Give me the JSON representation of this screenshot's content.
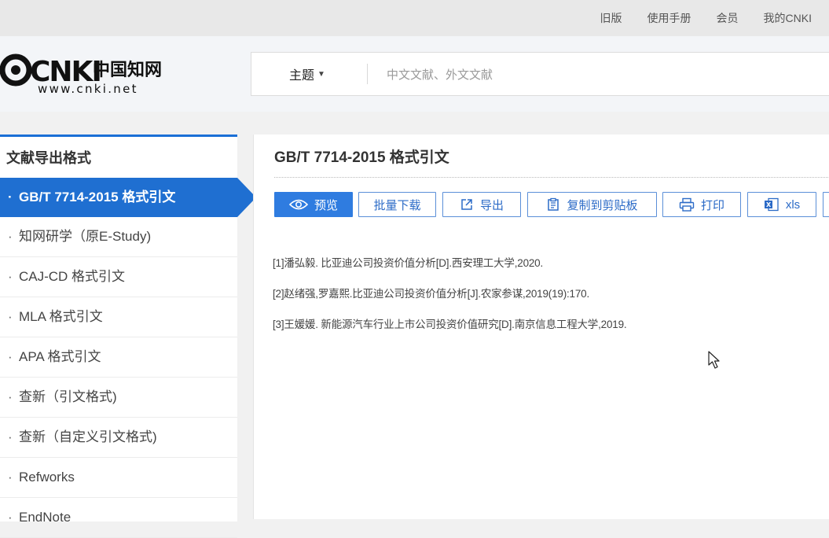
{
  "top_links": [
    "旧版",
    "使用手册",
    "会员",
    "我的CNKI"
  ],
  "logo": {
    "mark": "CNKI",
    "chinese": "中国知网",
    "url_text": "www.cnki.net"
  },
  "search": {
    "field": "主题",
    "placeholder": "中文文献、外文文献",
    "value": ""
  },
  "sidebar": {
    "title": "文献导出格式",
    "items": [
      {
        "label": "GB/T 7714-2015 格式引文",
        "active": true
      },
      {
        "label": "知网研学（原E-Study)",
        "active": false
      },
      {
        "label": "CAJ-CD 格式引文",
        "active": false
      },
      {
        "label": "MLA 格式引文",
        "active": false
      },
      {
        "label": "APA 格式引文",
        "active": false
      },
      {
        "label": "查新（引文格式)",
        "active": false
      },
      {
        "label": "查新（自定义引文格式)",
        "active": false
      },
      {
        "label": "Refworks",
        "active": false
      },
      {
        "label": "EndNote",
        "active": false
      }
    ]
  },
  "main": {
    "title": "GB/T 7714-2015 格式引文",
    "toolbar": {
      "preview": "预览",
      "batch_download": "批量下载",
      "export": "导出",
      "copy": "复制到剪贴板",
      "print": "打印",
      "xls": "xls"
    },
    "references": [
      "[1]潘弘毅. 比亚迪公司投资价值分析[D].西安理工大学,2020.",
      "[2]赵绪强,罗嘉熙.比亚迪公司投资价值分析[J].农家参谋,2019(19):170.",
      "[3]王媛媛. 新能源汽车行业上市公司投资价值研究[D].南京信息工程大学,2019."
    ]
  },
  "colors": {
    "accent": "#1f6fd1",
    "button_border": "#5b8fd8",
    "button_primary": "#2f7ce0"
  },
  "icons": [
    "eye-icon",
    "external-link-icon",
    "clipboard-icon",
    "printer-icon",
    "excel-icon",
    "caret-down-icon",
    "mouse-cursor-icon"
  ]
}
